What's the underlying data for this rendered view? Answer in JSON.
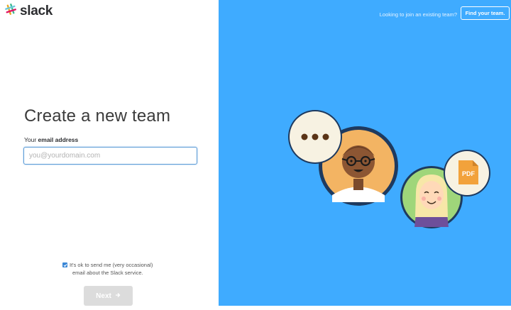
{
  "brand": {
    "name": "slack",
    "logo_icon": "slack-hash-logo-icon"
  },
  "header": {
    "join_prompt": "Looking to join an existing team?",
    "find_team_label": "Find your team."
  },
  "form": {
    "title": "Create a new team",
    "email_label_prefix": "Your ",
    "email_label_bold": "email address",
    "email_placeholder": "you@yourdomain.com",
    "email_value": "",
    "consent_checked": true,
    "consent_line1": "It's ok to send me (very occasional)",
    "consent_line2": "email about the Slack service.",
    "next_label": "Next",
    "next_icon": "arrow-right-icon"
  },
  "illustration": {
    "background_color": "#3fabff",
    "speech_bubble_icon": "ellipsis-speech-bubble-icon",
    "pdf_badge_text": "PDF"
  }
}
